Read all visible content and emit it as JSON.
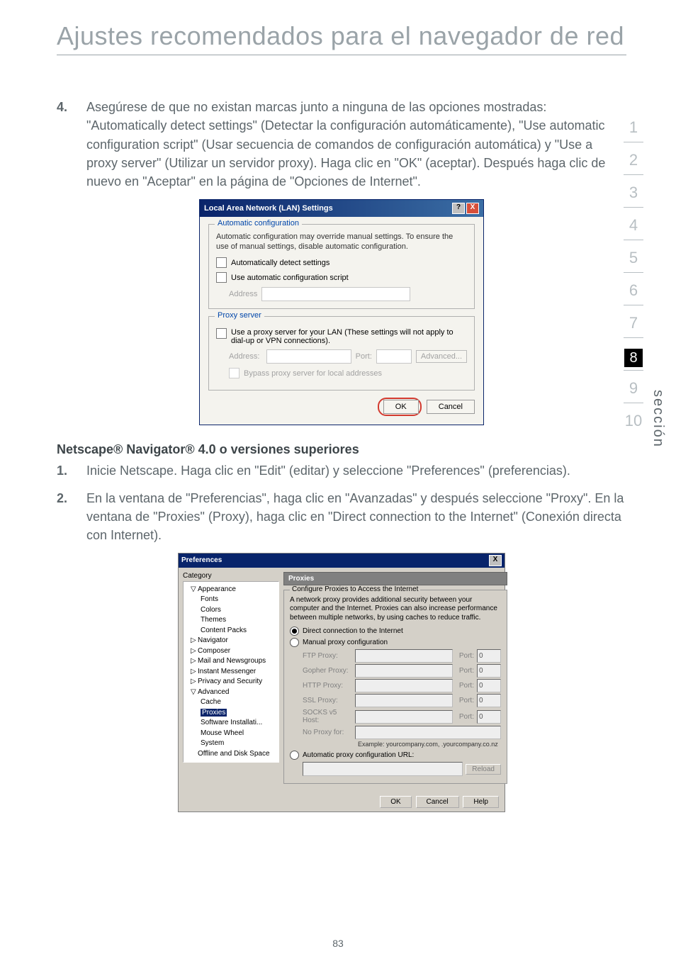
{
  "title": "Ajustes recomendados para el navegador de red",
  "step4_num": "4.",
  "step4_body": "Asegúrese de que no existan marcas junto a ninguna de las opciones mostradas: \"Automatically detect settings\" (Detectar la configuración automáticamente), \"Use automatic configuration script\" (Usar secuencia de comandos de configuración automática) y \"Use a proxy server\" (Utilizar un servidor proxy). Haga clic en \"OK\" (aceptar). Después haga clic de nuevo en \"Aceptar\" en la página de \"Opciones de Internet\".",
  "lan": {
    "title": "Local Area Network (LAN) Settings",
    "help_glyph": "?",
    "close_glyph": "X",
    "legend_auto": "Automatic configuration",
    "auto_desc": "Automatic configuration may override manual settings.  To ensure the use of manual settings, disable automatic configuration.",
    "chk_auto_detect": "Automatically detect settings",
    "chk_auto_script": "Use automatic configuration script",
    "address_label": "Address",
    "legend_proxy": "Proxy server",
    "proxy_desc": "Use a proxy server for your LAN (These settings will not apply to dial-up or VPN connections).",
    "addr2_label": "Address:",
    "port_label": "Port:",
    "advanced_btn": "Advanced...",
    "bypass_label": "Bypass proxy server for local addresses",
    "ok": "OK",
    "cancel": "Cancel"
  },
  "subhead": "Netscape® Navigator® 4.0 o versiones superiores",
  "ns1_num": "1.",
  "ns1_body": "Inicie Netscape. Haga clic en \"Edit\" (editar) y seleccione \"Preferences\" (preferencias).",
  "ns2_num": "2.",
  "ns2_body": "En la ventana de \"Preferencias\", haga clic en \"Avanzadas\" y después seleccione \"Proxy\". En la ventana de \"Proxies\" (Proxy), haga clic en \"Direct connection to the Internet\" (Conexión directa con Internet).",
  "pref": {
    "title": "Preferences",
    "close_glyph": "X",
    "category": "Category",
    "tree": {
      "appearance": "Appearance",
      "fonts": "Fonts",
      "colors": "Colors",
      "themes": "Themes",
      "content_packs": "Content Packs",
      "navigator": "Navigator",
      "composer": "Composer",
      "mail": "Mail and Newsgroups",
      "im": "Instant Messenger",
      "privacy": "Privacy and Security",
      "advanced": "Advanced",
      "cache": "Cache",
      "proxies": "Proxies",
      "software": "Software Installati...",
      "mouse": "Mouse Wheel",
      "system": "System",
      "offline": "Offline and Disk Space"
    },
    "header": "Proxies",
    "group_legend": "Configure Proxies to Access the Internet",
    "desc": "A network proxy provides additional security between your computer and the Internet. Proxies can also increase performance between multiple networks, by using caches to reduce traffic.",
    "radio_direct": "Direct connection to the Internet",
    "radio_manual": "Manual proxy configuration",
    "ftp": "FTP Proxy:",
    "gopher": "Gopher Proxy:",
    "http": "HTTP Proxy:",
    "ssl": "SSL Proxy:",
    "socks": "SOCKS v5 Host:",
    "noproxy": "No Proxy for:",
    "port": "Port:",
    "port_val": "0",
    "example": "Example: yourcompany.com, .yourcompany.co.nz",
    "radio_auto": "Automatic proxy configuration URL:",
    "reload": "Reload",
    "ok": "OK",
    "cancel": "Cancel",
    "help": "Help"
  },
  "tabs": {
    "t1": "1",
    "t2": "2",
    "t3": "3",
    "t4": "4",
    "t5": "5",
    "t6": "6",
    "t7": "7",
    "t8": "8",
    "t9": "9",
    "t10": "10"
  },
  "side_label": "sección",
  "page_number": "83"
}
